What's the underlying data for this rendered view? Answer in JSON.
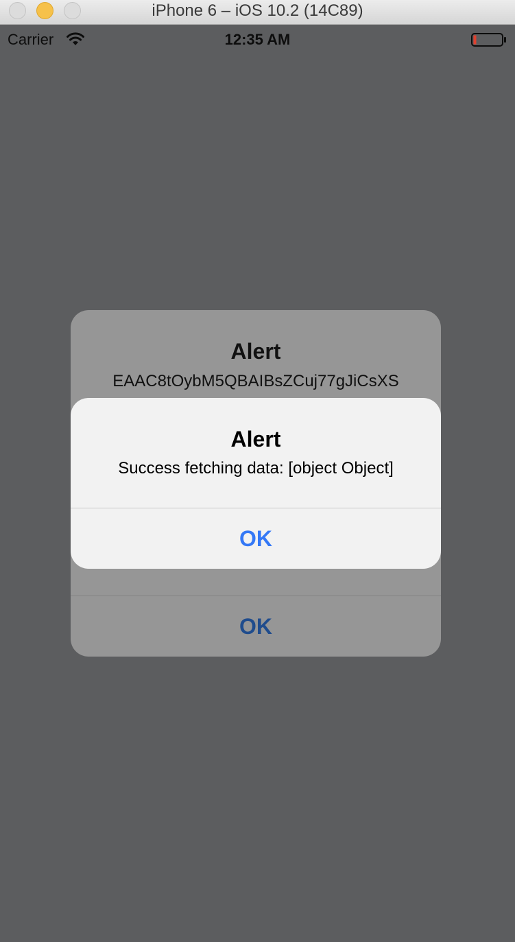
{
  "window": {
    "title": "iPhone 6 – iOS 10.2 (14C89)"
  },
  "status_bar": {
    "carrier": "Carrier",
    "time": "12:35 AM"
  },
  "background_alert": {
    "title": "Alert",
    "message": "EAAC8tOybM5QBAIBsZCuj77gJiCsXS",
    "ok_label": "OK"
  },
  "front_alert": {
    "title": "Alert",
    "message": "Success fetching data: [object Object]",
    "ok_label": "OK"
  },
  "colors": {
    "accent_blue": "#3478f6",
    "dimmed_blue": "#1f4c8d",
    "battery_low": "#e0412f"
  }
}
